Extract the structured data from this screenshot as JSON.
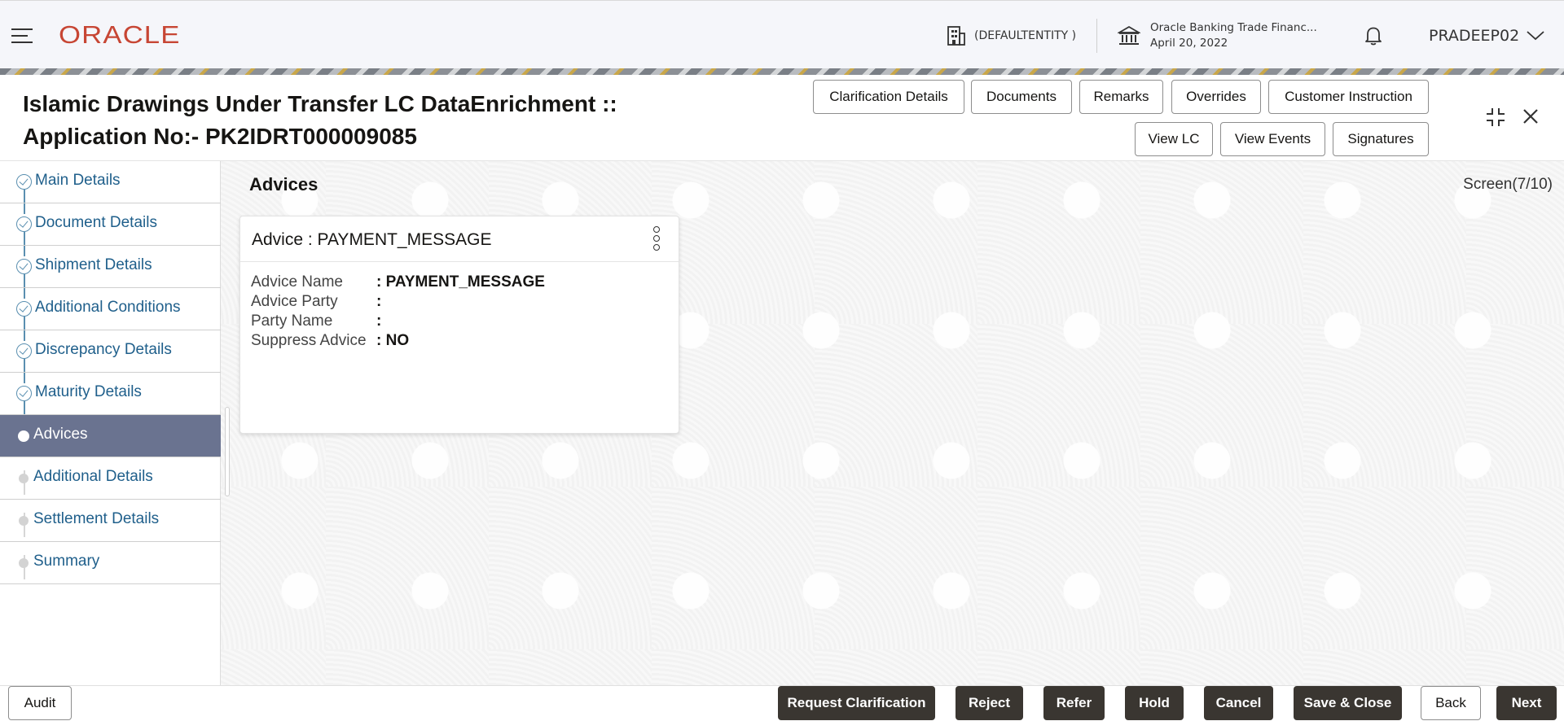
{
  "header": {
    "brand": "ORACLE",
    "entity": "(DEFAULTENTITY )",
    "app_name": "Oracle Banking Trade Financ...",
    "date": "April 20, 2022",
    "user": "PRADEEP02"
  },
  "title": {
    "line1": "Islamic Drawings Under Transfer LC DataEnrichment ::",
    "line2": "Application No:- PK2IDRT000009085"
  },
  "toolbar": {
    "row1": [
      "Clarification Details",
      "Documents",
      "Remarks",
      "Overrides",
      "Customer Instruction"
    ],
    "row2": [
      "View LC",
      "View Events",
      "Signatures"
    ]
  },
  "sidebar": {
    "steps": [
      {
        "label": "Main Details",
        "state": "done"
      },
      {
        "label": "Document Details",
        "state": "done"
      },
      {
        "label": "Shipment Details",
        "state": "done"
      },
      {
        "label": "Additional Conditions",
        "state": "done"
      },
      {
        "label": "Discrepancy Details",
        "state": "done"
      },
      {
        "label": "Maturity Details",
        "state": "done"
      },
      {
        "label": "Advices",
        "state": "active"
      },
      {
        "label": "Additional Details",
        "state": "pending"
      },
      {
        "label": "Settlement Details",
        "state": "pending"
      },
      {
        "label": "Summary",
        "state": "pending"
      }
    ]
  },
  "main": {
    "section_title": "Advices",
    "screen_count": "Screen(7/10)",
    "card": {
      "title": "Advice : PAYMENT_MESSAGE",
      "fields": [
        {
          "label": "Advice Name",
          "value": ": PAYMENT_MESSAGE"
        },
        {
          "label": "Advice Party",
          "value": ":"
        },
        {
          "label": "Party Name",
          "value": ":"
        },
        {
          "label": "Suppress Advice",
          "value": ": NO"
        }
      ]
    }
  },
  "footer": {
    "audit": "Audit",
    "request_clarification": "Request Clarification",
    "reject": "Reject",
    "refer": "Refer",
    "hold": "Hold",
    "cancel": "Cancel",
    "save_close": "Save & Close",
    "back": "Back",
    "next": "Next"
  },
  "colors": {
    "brand": "#c74634",
    "active_step": "#6a7390",
    "link": "#1f5f8b",
    "dark_button": "#3a3631"
  },
  "icons": [
    "menu-icon",
    "building-icon",
    "bank-icon",
    "bell-icon",
    "chevron-down-icon",
    "compress-icon",
    "close-icon",
    "check-circle-icon",
    "kebab-icon"
  ]
}
